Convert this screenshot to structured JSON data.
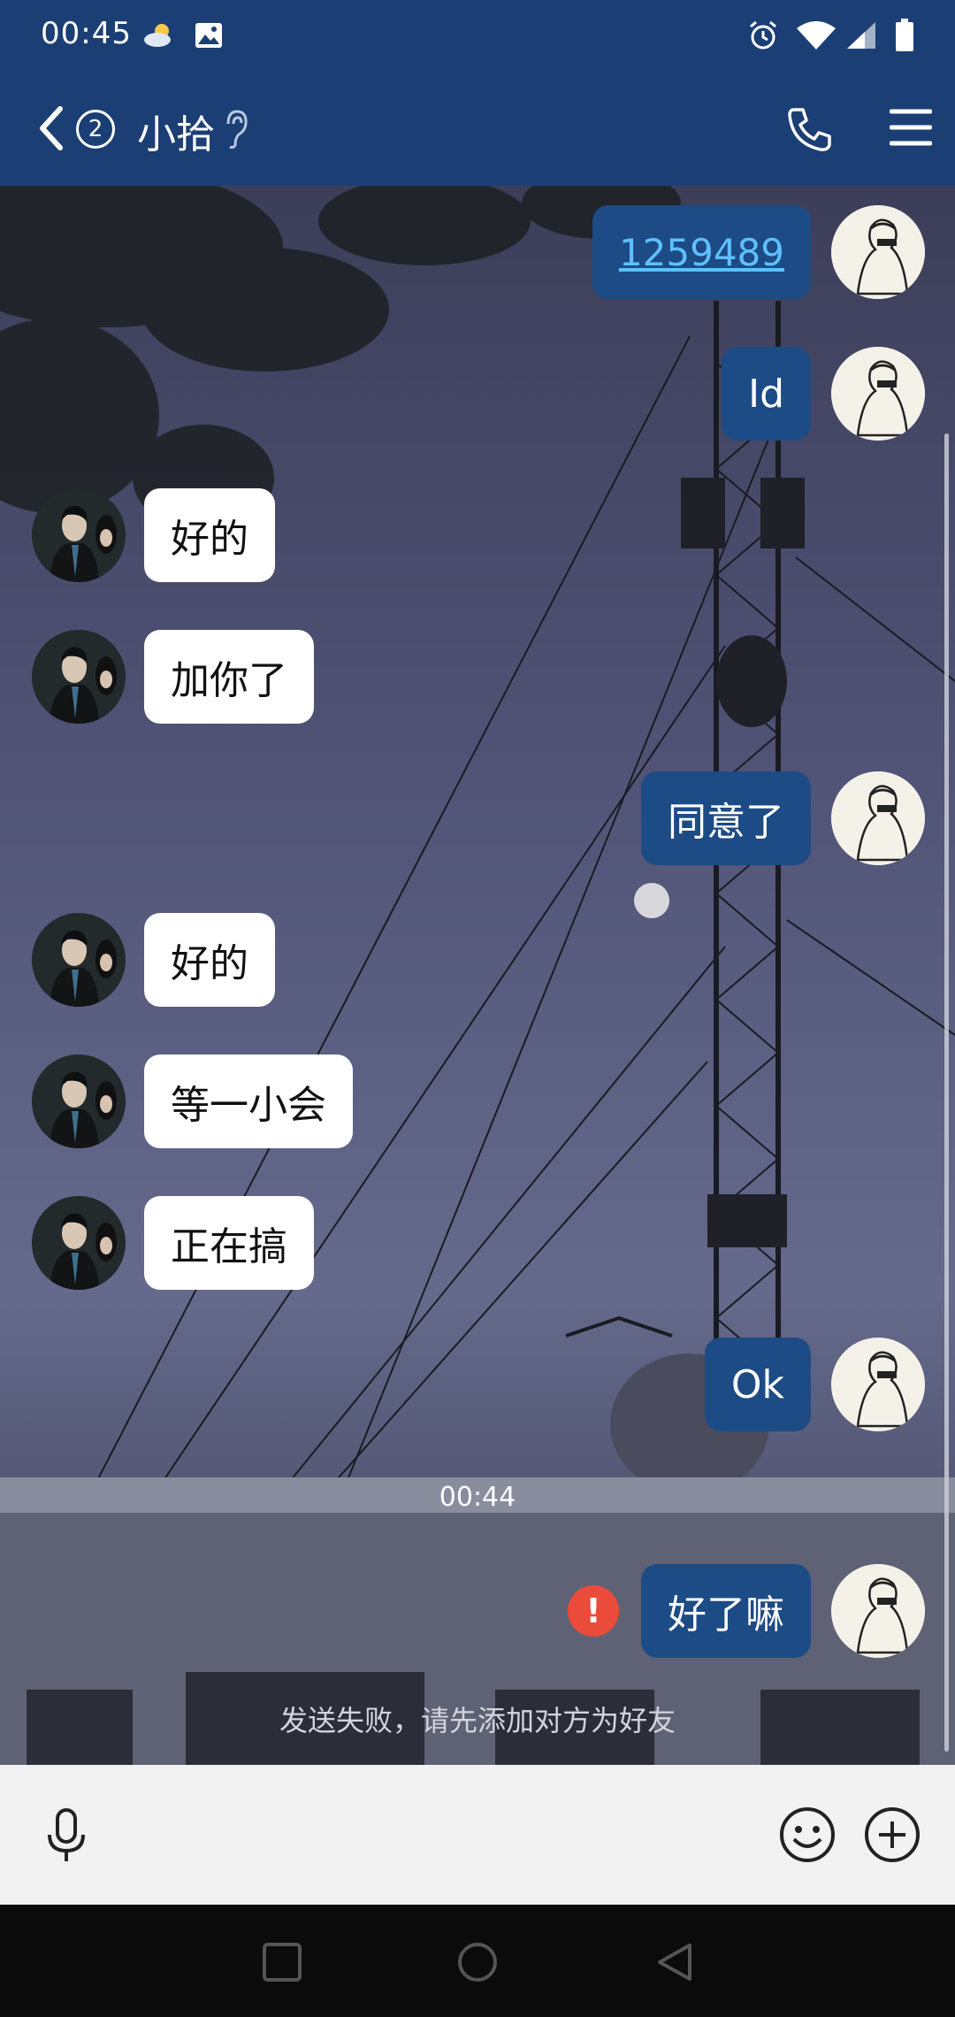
{
  "status_bar": {
    "time": "00:45",
    "icons": [
      "weather-cloudy-icon",
      "image-notification-icon",
      "alarm-icon",
      "wifi-icon",
      "signal-icon",
      "battery-icon"
    ]
  },
  "header": {
    "unread_badge": "②",
    "title": "小拾",
    "icons": [
      "back-arrow-icon",
      "ear-icon",
      "phone-icon",
      "menu-icon"
    ]
  },
  "colors": {
    "header_bg": "#1b3f74",
    "my_bubble": "#1d4b85",
    "their_bubble": "#ffffff",
    "link": "#5fc0ff",
    "error": "#ea4b3a"
  },
  "messages": [
    {
      "side": "me",
      "text": "1259489",
      "link": true
    },
    {
      "side": "me",
      "text": "Id"
    },
    {
      "side": "them",
      "text": "好的"
    },
    {
      "side": "them",
      "text": "加你了"
    },
    {
      "side": "me",
      "text": "同意了"
    },
    {
      "side": "them",
      "text": "好的"
    },
    {
      "side": "them",
      "text": "等一小会"
    },
    {
      "side": "them",
      "text": "正在搞"
    },
    {
      "side": "me",
      "text": "Ok"
    },
    {
      "side": "me",
      "text": "好了嘛",
      "failed": true
    }
  ],
  "timestamp": "00:44",
  "failure_notice": "发送失败，请先添加对方为好友",
  "input_bar": {
    "icons": [
      "microphone-icon",
      "emoji-icon",
      "add-icon"
    ]
  },
  "nav_bar": {
    "icons": [
      "recent-apps-icon",
      "home-icon",
      "back-icon"
    ]
  }
}
